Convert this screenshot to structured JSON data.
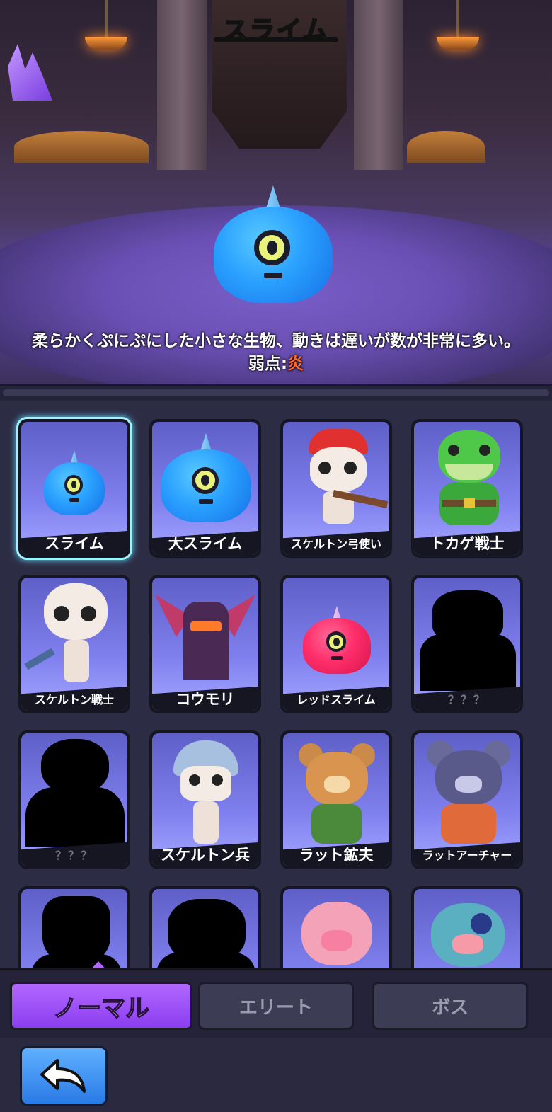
{
  "header": {
    "title": "スライム"
  },
  "detail": {
    "description": "柔らかくぷにぷにした小さな生物、動きは遅いが数が非常に多い。",
    "weakness_label": "弱点:",
    "weakness_value": "炎"
  },
  "monsters": [
    {
      "name": "スライム",
      "selected": true
    },
    {
      "name": "大スライム"
    },
    {
      "name": "スケルトン弓使い"
    },
    {
      "name": "トカゲ戦士"
    },
    {
      "name": "スケルトン戦士"
    },
    {
      "name": "コウモリ"
    },
    {
      "name": "レッドスライム"
    },
    {
      "name": "？？？",
      "locked": true
    },
    {
      "name": "？？？",
      "locked": true
    },
    {
      "name": "スケルトン兵"
    },
    {
      "name": "ラット鉱夫"
    },
    {
      "name": "ラットアーチャー"
    },
    {
      "name": "",
      "locked": true
    },
    {
      "name": "",
      "locked": true
    },
    {
      "name": ""
    },
    {
      "name": ""
    }
  ],
  "tabs": [
    {
      "label": "ノーマル",
      "active": true
    },
    {
      "label": "エリート"
    },
    {
      "label": "ボス"
    }
  ],
  "colors": {
    "accent": "#b267ff",
    "weakness": "#ff6a2a",
    "selected_glow": "#62dfff",
    "back_button": "#2a7ae6"
  }
}
